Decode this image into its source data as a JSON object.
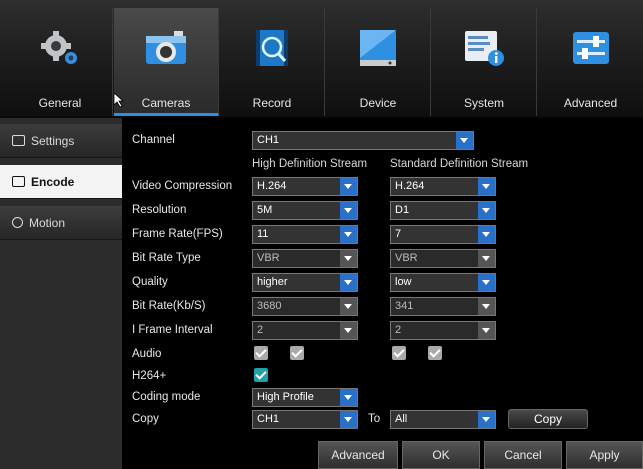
{
  "tabs": [
    {
      "label": "General",
      "icon": "gear-icon"
    },
    {
      "label": "Cameras",
      "icon": "camera-icon",
      "active": true
    },
    {
      "label": "Record",
      "icon": "record-icon"
    },
    {
      "label": "Device",
      "icon": "hard-drive-icon"
    },
    {
      "label": "System",
      "icon": "system-info-icon"
    },
    {
      "label": "Advanced",
      "icon": "sliders-icon"
    }
  ],
  "sidebar": {
    "items": [
      {
        "label": "Settings",
        "icon": "monitor-icon"
      },
      {
        "label": "Encode",
        "icon": "encode-icon",
        "active": true
      },
      {
        "label": "Motion",
        "icon": "motion-icon"
      }
    ]
  },
  "form": {
    "channel": {
      "label": "Channel",
      "value": "CH1"
    },
    "headers": {
      "hd": "High Definition Stream",
      "sd": "Standard  Definition Stream"
    },
    "video_compression": {
      "label": "Video Compression",
      "hd": "H.264",
      "sd": "H.264"
    },
    "resolution": {
      "label": "Resolution",
      "hd": "5M",
      "sd": "D1"
    },
    "frame_rate": {
      "label": "Frame Rate(FPS)",
      "hd": "11",
      "sd": "7"
    },
    "bit_rate_type": {
      "label": "Bit Rate Type",
      "hd": "VBR",
      "sd": "VBR"
    },
    "quality": {
      "label": "Quality",
      "hd": "higher",
      "sd": "low"
    },
    "bit_rate": {
      "label": "Bit Rate(Kb/S)",
      "hd": "3680",
      "sd": "341"
    },
    "iframe_interval": {
      "label": "I Frame Interval",
      "hd": "2",
      "sd": "2"
    },
    "audio": {
      "label": "Audio"
    },
    "h264plus": {
      "label": "H264+"
    },
    "coding_mode": {
      "label": "Coding mode",
      "value": "High Profile"
    },
    "copy": {
      "label": "Copy",
      "from": "CH1",
      "to_label": "To",
      "to": "All",
      "button": "Copy"
    }
  },
  "footer": {
    "advanced": "Advanced",
    "ok": "OK",
    "cancel": "Cancel",
    "apply": "Apply"
  },
  "colors": {
    "accent": "#2870c8",
    "active_underline": "#2f8fe0",
    "checkbox_teal": "#1fa3a8"
  }
}
